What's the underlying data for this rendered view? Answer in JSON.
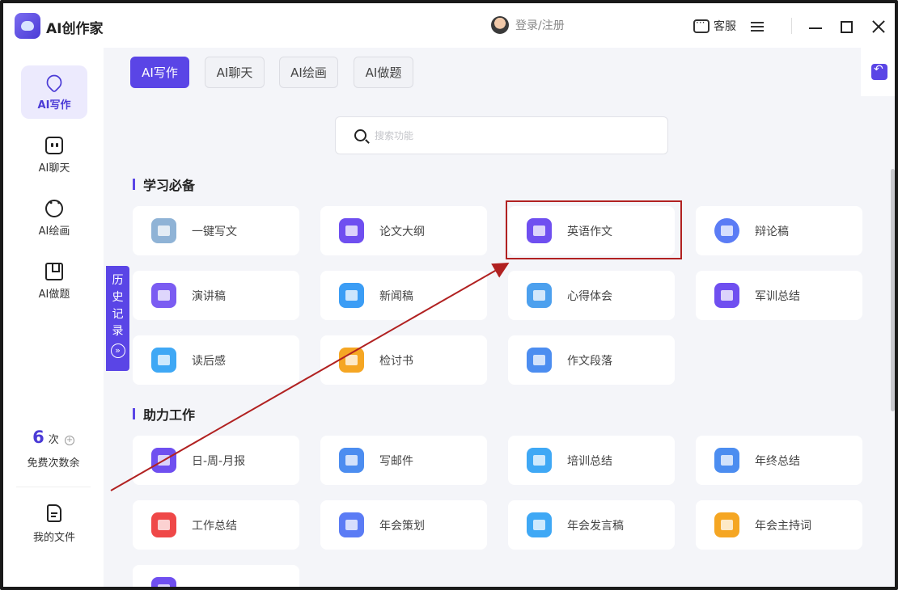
{
  "app": {
    "title": "AI创作家"
  },
  "header": {
    "login": "登录/注册",
    "service": "客服"
  },
  "sidebar": {
    "items": [
      {
        "label": "AI写作",
        "icon": "pen-icon"
      },
      {
        "label": "AI聊天",
        "icon": "chat-icon"
      },
      {
        "label": "AI绘画",
        "icon": "palette-icon"
      },
      {
        "label": "AI做题",
        "icon": "bookmark-icon"
      }
    ],
    "free_count": "6",
    "free_unit": "次",
    "free_label": "免费次数余",
    "my_files": "我的文件"
  },
  "tabs": [
    "AI写作",
    "AI聊天",
    "AI绘画",
    "AI做题"
  ],
  "search": {
    "placeholder": "搜索功能"
  },
  "history": {
    "label": "历史记录"
  },
  "sections": [
    {
      "title": "学习必备",
      "cards": [
        {
          "label": "一键写文",
          "color": "#8fb3d6"
        },
        {
          "label": "论文大纲",
          "color": "#6f4ff0"
        },
        {
          "label": "英语作文",
          "color": "#6f4ff0"
        },
        {
          "label": "辩论稿",
          "color": "#5b7cf5"
        },
        {
          "label": "演讲稿",
          "color": "#7b5cf2"
        },
        {
          "label": "新闻稿",
          "color": "#3b9df5"
        },
        {
          "label": "心得体会",
          "color": "#4ca0ee"
        },
        {
          "label": "军训总结",
          "color": "#6f4ff0"
        },
        {
          "label": "读后感",
          "color": "#3fa8f5"
        },
        {
          "label": "检讨书",
          "color": "#f5a623"
        },
        {
          "label": "作文段落",
          "color": "#4c8df0"
        }
      ]
    },
    {
      "title": "助力工作",
      "cards": [
        {
          "label": "日-周-月报",
          "color": "#6f4ff0"
        },
        {
          "label": "写邮件",
          "color": "#4c8df0"
        },
        {
          "label": "培训总结",
          "color": "#3fa8f5"
        },
        {
          "label": "年终总结",
          "color": "#4c8df0"
        },
        {
          "label": "工作总结",
          "color": "#ef4848"
        },
        {
          "label": "年会策划",
          "color": "#5b7cf5"
        },
        {
          "label": "年会发言稿",
          "color": "#3fa8f5"
        },
        {
          "label": "年会主持词",
          "color": "#f5a623"
        }
      ]
    }
  ],
  "colors": {
    "accent": "#5a45e6",
    "annotation": "#b12121"
  }
}
